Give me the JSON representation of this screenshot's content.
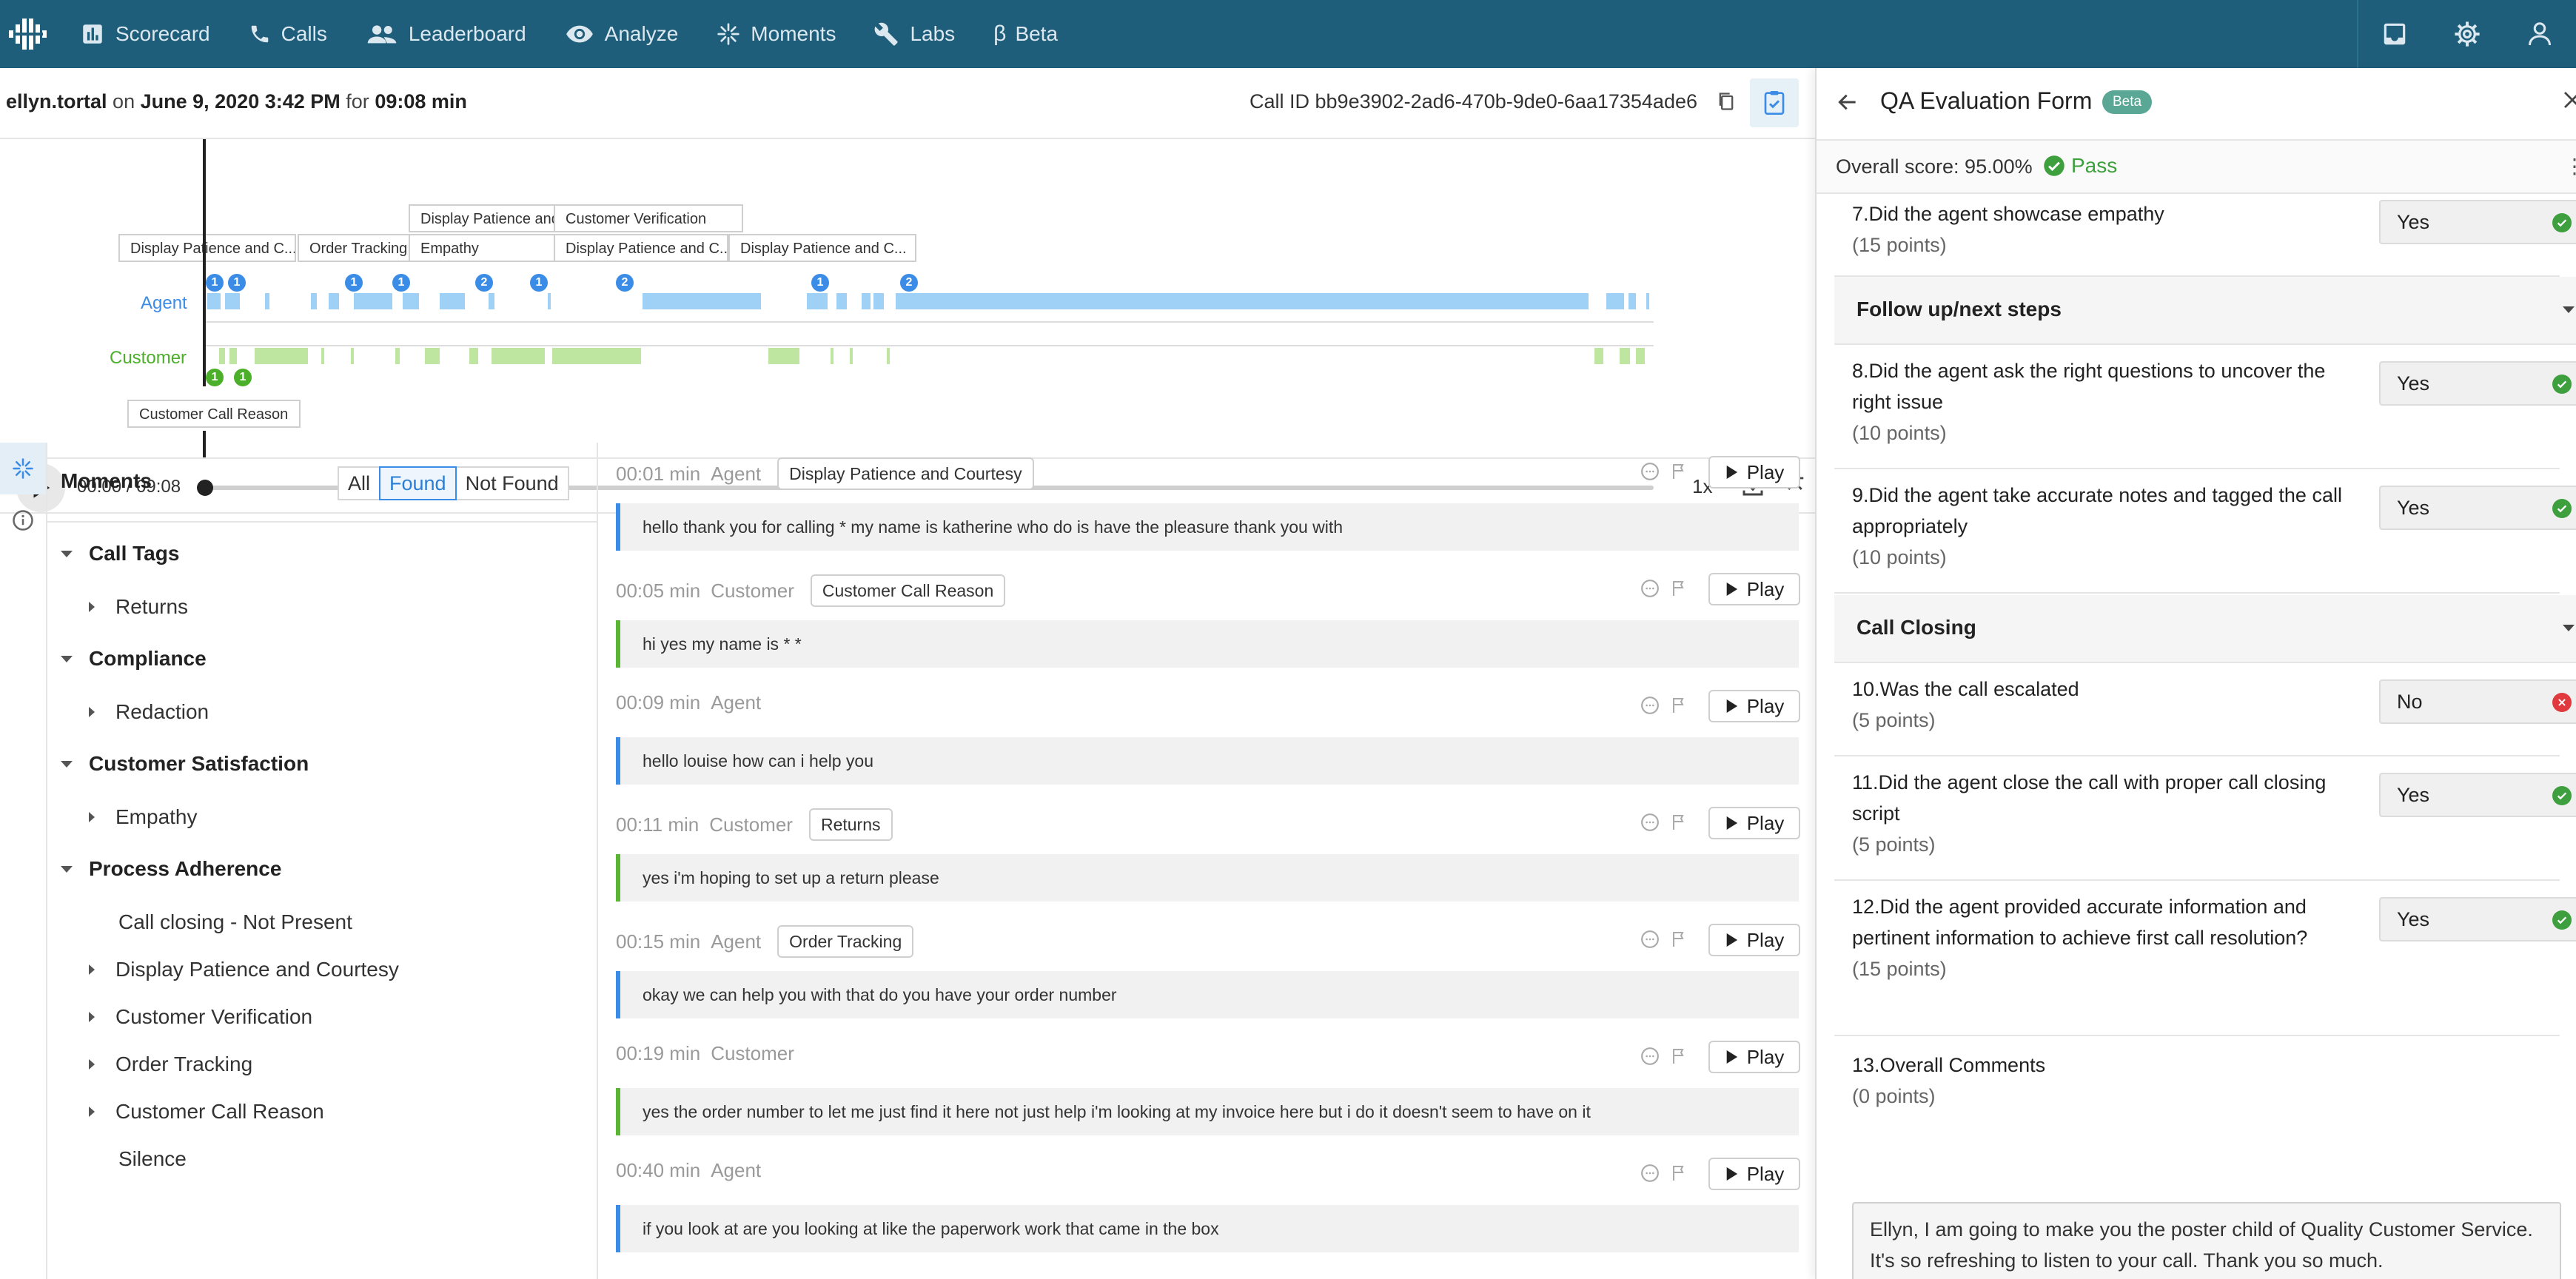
{
  "nav": {
    "items": [
      {
        "label": "Scorecard",
        "icon": "bar-chart-icon"
      },
      {
        "label": "Calls",
        "icon": "phone-icon"
      },
      {
        "label": "Leaderboard",
        "icon": "people-icon"
      },
      {
        "label": "Analyze",
        "icon": "eye-icon"
      },
      {
        "label": "Moments",
        "icon": "sparkle-icon"
      },
      {
        "label": "Labs",
        "icon": "wrench-icon"
      },
      {
        "label": "Beta",
        "icon": "beta-icon"
      }
    ]
  },
  "call": {
    "agent": "ellyn.tortal",
    "on": "on",
    "date": "June 9, 2020 3:42 PM",
    "for": "for",
    "duration": "09:08 min",
    "call_id": "Call ID bb9e3902-2ad6-470b-9de0-6aa17354ade6"
  },
  "timeline": {
    "agent_label": "Agent",
    "customer_label": "Customer",
    "tags": [
      "Display Patience and C...",
      "Order Tracking",
      "Display Patience and",
      "Empathy",
      "Customer Verification",
      "Display Patience and C...",
      "Display Patience and C..."
    ],
    "customer_tag": "Customer Call Reason",
    "agent_bubbles": [
      "1",
      "1",
      "1",
      "1",
      "2",
      "1",
      "2",
      "1",
      "2"
    ],
    "customer_bubbles": [
      "1",
      "1"
    ],
    "agent_color": "#9fd0f5",
    "customer_color": "#bfe6a0"
  },
  "player": {
    "time": "00:00 / 09:08",
    "speed": "1x",
    "progress": 0
  },
  "moments": {
    "title": "Moments",
    "filters": [
      "All",
      "Found",
      "Not Found"
    ],
    "selected_filter": "Found",
    "tree": [
      {
        "label": "Call Tags",
        "children": [
          "Returns"
        ]
      },
      {
        "label": "Compliance",
        "children": [
          "Redaction"
        ]
      },
      {
        "label": "Customer Satisfaction",
        "children": [
          "Empathy"
        ]
      },
      {
        "label": "Process Adherence",
        "children": [
          "Call closing - Not Present",
          "Display Patience and Courtesy",
          "Customer Verification",
          "Order Tracking",
          "Customer Call Reason",
          "Silence"
        ]
      }
    ]
  },
  "transcript": {
    "play_label": "Play",
    "entries": [
      {
        "time": "00:01 min",
        "speaker": "Agent",
        "tag": "Display Patience and Courtesy",
        "text": "hello thank you for calling * my name is katherine who do is have the pleasure thank you with"
      },
      {
        "time": "00:05 min",
        "speaker": "Customer",
        "tag": "Customer Call Reason",
        "text": "hi yes my name is * *"
      },
      {
        "time": "00:09 min",
        "speaker": "Agent",
        "tag": "",
        "text": "hello louise how can i help you"
      },
      {
        "time": "00:11 min",
        "speaker": "Customer",
        "tag": "Returns",
        "text": "yes i'm hoping to set up a return please"
      },
      {
        "time": "00:15 min",
        "speaker": "Agent",
        "tag": "Order Tracking",
        "text": "okay we can help you with that do you have your order number"
      },
      {
        "time": "00:19 min",
        "speaker": "Customer",
        "tag": "",
        "text": "yes the order number to let me just find it here not just help i'm looking at my invoice here but i do it doesn't seem to have on it"
      },
      {
        "time": "00:40 min",
        "speaker": "Agent",
        "tag": "",
        "text": "if you look at are you looking at like the paperwork work that came in the box"
      }
    ]
  },
  "qa": {
    "title": "QA Evaluation Form",
    "badge": "Beta",
    "overall": "Overall score: 95.00%",
    "result": "Pass",
    "questions": [
      {
        "q": "7.Did the agent showcase empathy",
        "pts": "(15 points)",
        "ans": "Yes"
      },
      {
        "q": "8.Did the agent ask the right questions to uncover the right issue",
        "pts": "(10 points)",
        "ans": "Yes"
      },
      {
        "q": "9.Did the agent take accurate notes and tagged the call appropriately",
        "pts": "(10 points)",
        "ans": "Yes"
      },
      {
        "q": "10.Was the call escalated",
        "pts": "(5 points)",
        "ans": "No"
      },
      {
        "q": "11.Did the agent close the call with proper call closing script",
        "pts": "(5 points)",
        "ans": "Yes"
      },
      {
        "q": "12.Did the agent provided accurate information and pertinent information to achieve first call resolution?",
        "pts": "(15 points)",
        "ans": "Yes"
      },
      {
        "q": "13.Overall Comments",
        "pts": "(0 points)",
        "ans": ""
      }
    ],
    "sections": [
      "Follow up/next steps",
      "Call Closing"
    ],
    "comment": "Ellyn, I am going to make you the poster child of Quality Customer Service. It's so refreshing to listen to your call. Thank you so much.",
    "yes_color": "#3e9f3e",
    "no_color": "#e0393e"
  }
}
